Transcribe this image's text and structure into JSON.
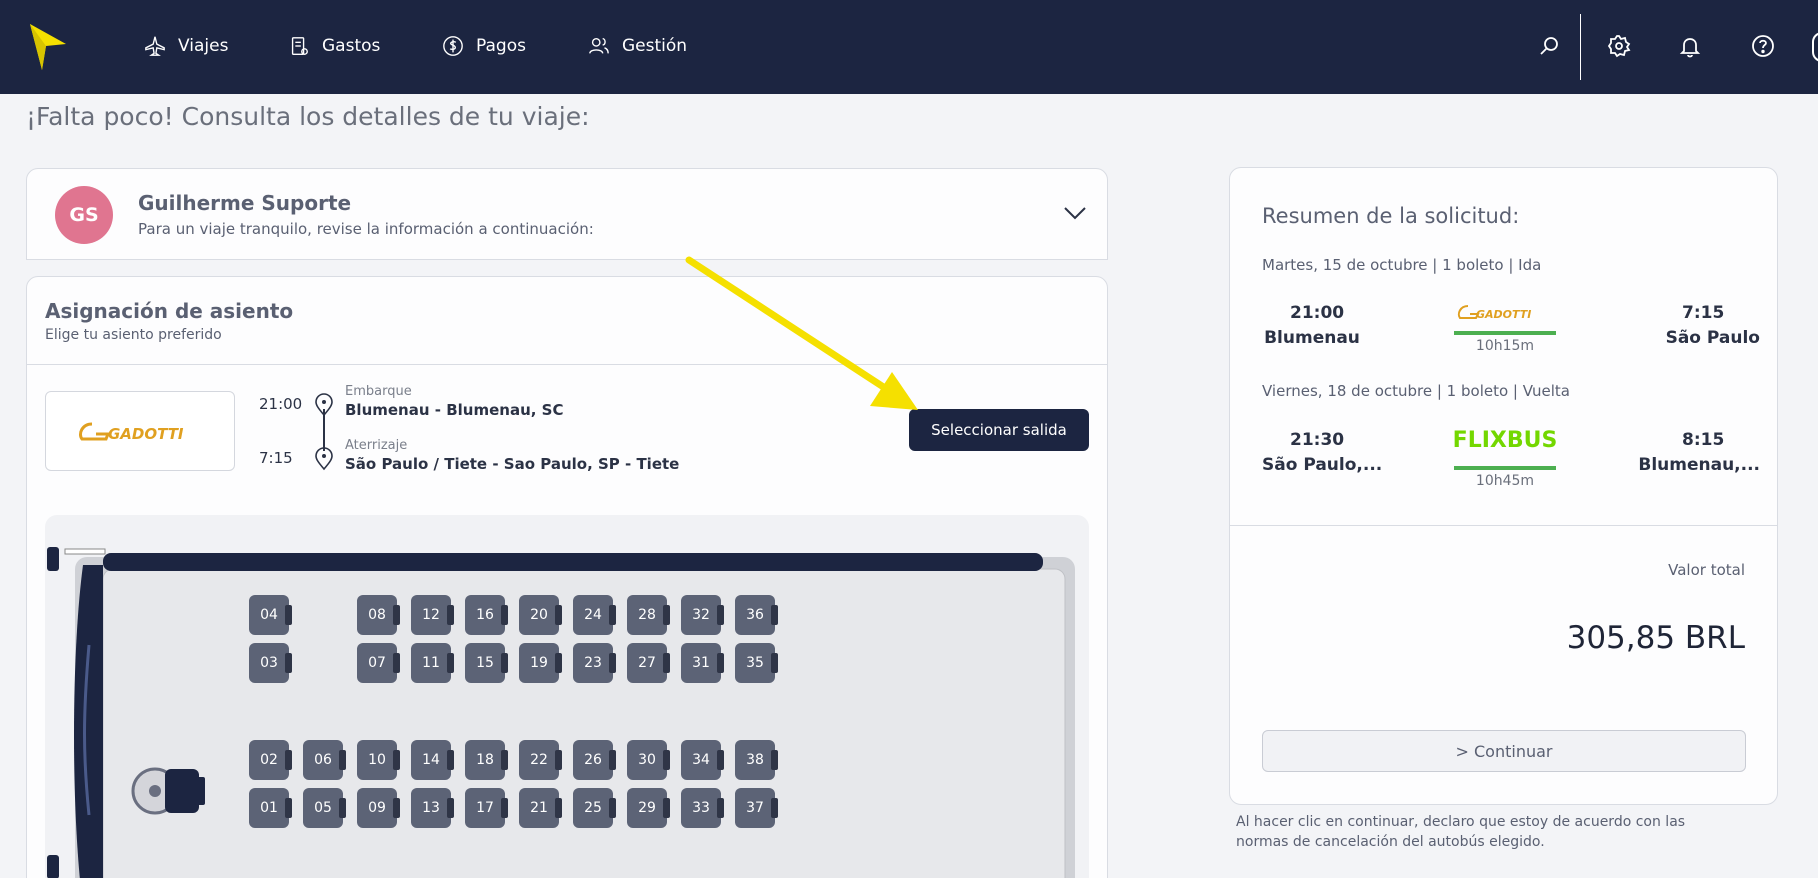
{
  "nav": {
    "items": [
      {
        "label": "Viajes",
        "icon": "plane-icon"
      },
      {
        "label": "Gastos",
        "icon": "receipt-icon"
      },
      {
        "label": "Pagos",
        "icon": "dollar-icon"
      },
      {
        "label": "Gestión",
        "icon": "users-icon"
      }
    ],
    "colors": {
      "bar": "#1c2541",
      "logo": "#f5e000"
    }
  },
  "page": {
    "title": "¡Falta poco! Consulta los detalles de tu viaje:"
  },
  "traveler": {
    "initials": "GS",
    "name": "Guilherme Suporte",
    "subtitle": "Para un viaje tranquilo, revise la información a continuación:"
  },
  "seat_section": {
    "title": "Asignación de asiento",
    "subtitle": "Elige tu asiento preferido",
    "carrier": "GADOTTI",
    "departure": {
      "time": "21:00",
      "label": "Embarque",
      "place": "Blumenau - Blumenau, SC"
    },
    "arrival": {
      "time": "7:15",
      "label": "Aterrizaje",
      "place": "São Paulo / Tiete - Sao Paulo, SP - Tiete"
    },
    "select_button": "Seleccionar salida",
    "seats": {
      "row_top_1": [
        "04",
        "08",
        "12",
        "16",
        "20",
        "24",
        "28",
        "32",
        "36"
      ],
      "row_top_2": [
        "03",
        "07",
        "11",
        "15",
        "19",
        "23",
        "27",
        "31",
        "35"
      ],
      "row_bottom_1": [
        "02",
        "06",
        "10",
        "14",
        "18",
        "22",
        "26",
        "30",
        "34",
        "38"
      ],
      "row_bottom_2": [
        "01",
        "05",
        "09",
        "13",
        "17",
        "21",
        "25",
        "29",
        "33",
        "37"
      ]
    }
  },
  "summary": {
    "title": "Resumen de la solicitud:",
    "outbound": {
      "line": "Martes, 15 de octubre | 1 boleto | Ida",
      "dep_time": "21:00",
      "dep_city": "Blumenau",
      "carrier": "GADOTTI",
      "duration": "10h15m",
      "arr_time": "7:15",
      "arr_city": "São Paulo"
    },
    "return": {
      "line": "Viernes, 18 de octubre | 1 boleto | Vuelta",
      "dep_time": "21:30",
      "dep_city": "São Paulo,...",
      "carrier": "FLIXBUS",
      "duration": "10h45m",
      "arr_time": "8:15",
      "arr_city": "Blumenau,..."
    },
    "total_label": "Valor total",
    "total_value": "305,85 BRL",
    "continue_button": "> Continuar"
  },
  "disclaimer": "Al hacer clic en continuar, declaro que estoy de acuerdo con las normas de cancelación del autobús elegido."
}
